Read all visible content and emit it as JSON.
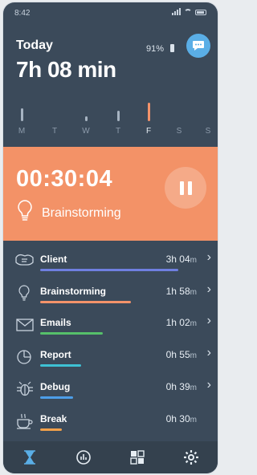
{
  "status_bar": {
    "time": "8:42"
  },
  "header": {
    "title": "Today",
    "total": "7h 08 min",
    "battery_percent": "91%"
  },
  "week": {
    "days": [
      {
        "label": "M",
        "level": 0.45,
        "active": false
      },
      {
        "label": "T",
        "level": 0.0,
        "active": false
      },
      {
        "label": "W",
        "level": 0.18,
        "active": false
      },
      {
        "label": "T",
        "level": 0.35,
        "active": false
      },
      {
        "label": "F",
        "level": 0.65,
        "active": true
      },
      {
        "label": "S",
        "level": 0.0,
        "active": false
      },
      {
        "label": "S",
        "level": 0.0,
        "active": false
      }
    ]
  },
  "timer": {
    "value": "00:30:04",
    "task": "Brainstorming",
    "icon": "lightbulb-icon"
  },
  "tasks": [
    {
      "name": "Client",
      "hours": "3h",
      "minutes": "04",
      "unit": "m",
      "color": "#6f7fe0",
      "progress": 0.84,
      "icon": "handshake-icon",
      "chevron": true
    },
    {
      "name": "Brainstorming",
      "hours": "1h",
      "minutes": "58",
      "unit": "m",
      "color": "#f4936a",
      "progress": 0.55,
      "icon": "lightbulb-icon",
      "chevron": true
    },
    {
      "name": "Emails",
      "hours": "1h",
      "minutes": "02",
      "unit": "m",
      "color": "#56c06a",
      "progress": 0.38,
      "icon": "envelope-icon",
      "chevron": true
    },
    {
      "name": "Report",
      "hours": "0h",
      "minutes": "55",
      "unit": "m",
      "color": "#3ec1d4",
      "progress": 0.25,
      "icon": "pie-chart-icon",
      "chevron": true
    },
    {
      "name": "Debug",
      "hours": "0h",
      "minutes": "39",
      "unit": "m",
      "color": "#4d9ee8",
      "progress": 0.2,
      "icon": "bug-icon",
      "chevron": true
    },
    {
      "name": "Break",
      "hours": "0h",
      "minutes": "30",
      "unit": "m",
      "color": "#f1a04a",
      "progress": 0.13,
      "icon": "coffee-cup-icon",
      "chevron": false
    }
  ],
  "bottom_nav": [
    {
      "name": "timer-nav-button",
      "icon": "hourglass-icon",
      "active": true
    },
    {
      "name": "reports-nav-button",
      "icon": "chart-circle-icon",
      "active": false
    },
    {
      "name": "projects-nav-button",
      "icon": "grid-icon",
      "active": false
    },
    {
      "name": "settings-nav-button",
      "icon": "gear-icon",
      "active": false
    }
  ],
  "colors": {
    "background": "#3b4a5a",
    "accent": "#f39267",
    "chat_button": "#5aaee6",
    "nav_active": "#5aaee6"
  }
}
